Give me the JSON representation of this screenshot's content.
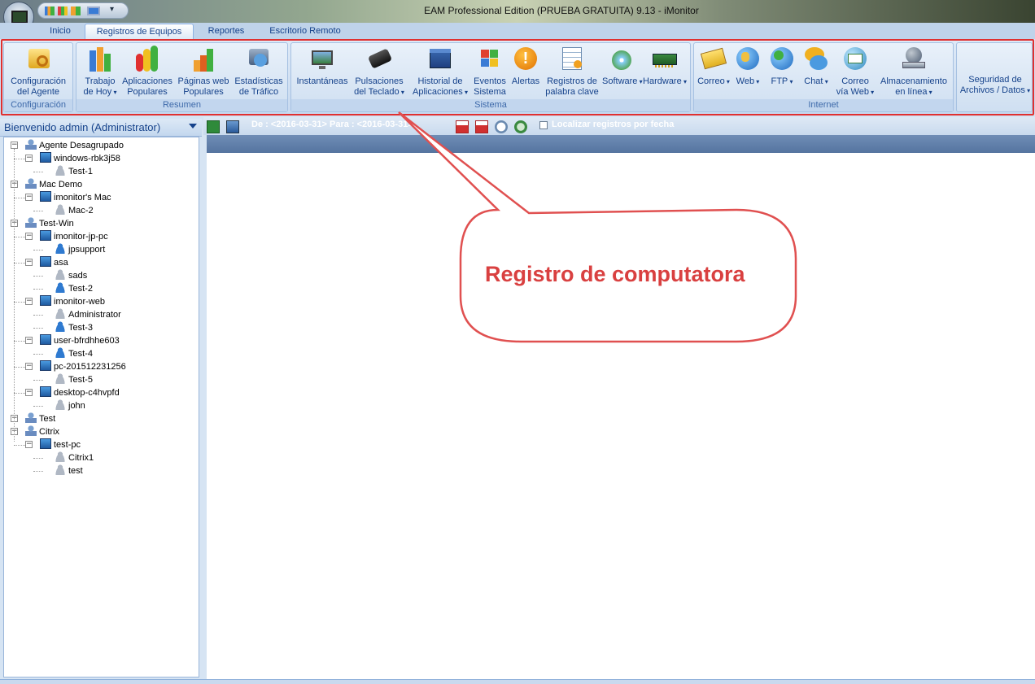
{
  "window": {
    "title": "EAM Professional Edition (PRUEBA GRATUITA) 9.13 - iMonitor"
  },
  "tabs": [
    {
      "label": "Inicio"
    },
    {
      "label": "Registros de Equipos"
    },
    {
      "label": "Reportes"
    },
    {
      "label": "Escritorio Remoto"
    }
  ],
  "ribbon": {
    "groups": [
      {
        "label": "Configuración"
      },
      {
        "label": "Resumen"
      },
      {
        "label": "Sistema"
      },
      {
        "label": "Internet"
      }
    ],
    "buttons": [
      {
        "label": "Configuración\ndel Agente",
        "icon": "agent-config-icon"
      },
      {
        "label": "Trabajo\nde Hoy",
        "icon": "bar-chart-icon"
      },
      {
        "label": "Aplicaciones\nPopulares",
        "icon": "app-chart-icon"
      },
      {
        "label": "Páginas web\nPopulares",
        "icon": "web-chart-icon"
      },
      {
        "label": "Estadísticas\nde Tráfico",
        "icon": "traffic-icon"
      },
      {
        "label": "Instantáneas",
        "icon": "screenshot-icon"
      },
      {
        "label": "Pulsaciones\ndel Teclado",
        "icon": "keyboard-icon"
      },
      {
        "label": "Historial de\nAplicaciones",
        "icon": "window-icon"
      },
      {
        "label": "Eventos\nSistema",
        "icon": "windows-logo-icon"
      },
      {
        "label": "Alertas",
        "icon": "alert-icon"
      },
      {
        "label": "Registros de\npalabra clave",
        "icon": "keyword-icon"
      },
      {
        "label": "Software",
        "icon": "software-icon"
      },
      {
        "label": "Hardware",
        "icon": "hardware-icon"
      },
      {
        "label": "Correo",
        "icon": "mail-icon"
      },
      {
        "label": "Web",
        "icon": "globe-icon"
      },
      {
        "label": "FTP",
        "icon": "ftp-icon"
      },
      {
        "label": "Chat",
        "icon": "chat-icon"
      },
      {
        "label": "Correo\nvía Web",
        "icon": "webmail-icon"
      },
      {
        "label": "Almacenamiento\nen línea",
        "icon": "storage-icon"
      },
      {
        "label": "Seguridad de\nArchivos / Datos",
        "icon": "security-icon"
      }
    ]
  },
  "left_panel": {
    "header": "Bienvenido admin (Administrator)"
  },
  "tree": [
    {
      "label": "Agente Desagrupado",
      "type": "group"
    },
    {
      "label": "windows-rbk3j58",
      "type": "computer"
    },
    {
      "label": "Test-1",
      "type": "user-gray"
    },
    {
      "label": "Mac Demo",
      "type": "group"
    },
    {
      "label": "imonitor's Mac",
      "type": "computer"
    },
    {
      "label": "Mac-2",
      "type": "user-gray"
    },
    {
      "label": "Test-Win",
      "type": "group"
    },
    {
      "label": "imonitor-jp-pc",
      "type": "computer"
    },
    {
      "label": "jpsupport",
      "type": "user-blue"
    },
    {
      "label": "asa",
      "type": "computer"
    },
    {
      "label": "sads",
      "type": "user-gray"
    },
    {
      "label": "Test-2",
      "type": "user-blue"
    },
    {
      "label": "imonitor-web",
      "type": "computer"
    },
    {
      "label": "Administrator",
      "type": "user-gray"
    },
    {
      "label": "Test-3",
      "type": "user-blue"
    },
    {
      "label": "user-bfrdhhe603",
      "type": "computer"
    },
    {
      "label": "Test-4",
      "type": "user-blue"
    },
    {
      "label": "pc-201512231256",
      "type": "computer"
    },
    {
      "label": "Test-5",
      "type": "user-gray"
    },
    {
      "label": "desktop-c4hvpfd",
      "type": "computer"
    },
    {
      "label": "john",
      "type": "user-gray"
    },
    {
      "label": "Test",
      "type": "group"
    },
    {
      "label": "Citrix",
      "type": "group"
    },
    {
      "label": "test-pc",
      "type": "computer"
    },
    {
      "label": "Citrix1",
      "type": "user-gray"
    },
    {
      "label": "test",
      "type": "user-gray"
    }
  ],
  "toolbar": {
    "date_range": "De : <2016-03-31> Para : <2016-03-31>",
    "locate_label": "Localizar registros por fecha"
  },
  "callout": {
    "text": "Registro de computatora"
  },
  "colors": {
    "highlight": "#e03030",
    "callout_text": "#d94040",
    "ribbon_text": "#15428b"
  }
}
